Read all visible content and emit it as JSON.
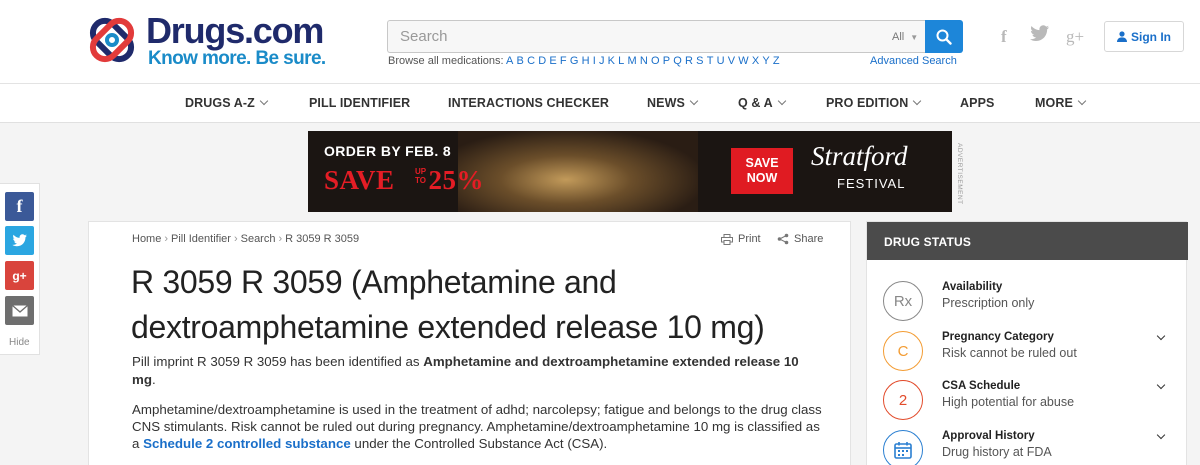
{
  "header": {
    "logo": {
      "name": "Drugs.com",
      "tagline": "Know more. Be sure."
    },
    "search": {
      "placeholder": "Search",
      "scope": "All"
    },
    "browse": {
      "label": "Browse all medications:",
      "letters": [
        "A",
        "B",
        "C",
        "D",
        "E",
        "F",
        "G",
        "H",
        "I",
        "J",
        "K",
        "L",
        "M",
        "N",
        "O",
        "P",
        "Q",
        "R",
        "S",
        "T",
        "U",
        "V",
        "W",
        "X",
        "Y",
        "Z"
      ]
    },
    "advanced_search": "Advanced Search",
    "social": {
      "facebook": "f",
      "twitter": "t",
      "googleplus": "g+"
    },
    "sign_in": "Sign In"
  },
  "nav": [
    {
      "label": "DRUGS A-Z",
      "dropdown": true
    },
    {
      "label": "PILL IDENTIFIER",
      "dropdown": false
    },
    {
      "label": "INTERACTIONS CHECKER",
      "dropdown": false
    },
    {
      "label": "NEWS",
      "dropdown": true
    },
    {
      "label": "Q & A",
      "dropdown": true
    },
    {
      "label": "PRO EDITION",
      "dropdown": true
    },
    {
      "label": "APPS",
      "dropdown": false
    },
    {
      "label": "MORE",
      "dropdown": true
    }
  ],
  "ad": {
    "order": "ORDER BY FEB. 8",
    "save": "SAVE",
    "up_to": "UP TO",
    "percent": "25%",
    "button": "SAVE NOW",
    "brand": "Stratford",
    "brand_sub": "FESTIVAL",
    "label": "ADVERTISEMENT"
  },
  "share_bar": {
    "hide": "Hide"
  },
  "breadcrumb": [
    "Home",
    "Pill Identifier",
    "Search",
    "R 3059 R 3059"
  ],
  "tools": {
    "print": "Print",
    "share": "Share"
  },
  "main": {
    "title": "R 3059 R 3059 (Amphetamine and dextroamphetamine extended release 10 mg)",
    "intro_prefix": "Pill imprint R 3059 R 3059 has been identified as ",
    "intro_bold": "Amphetamine and dextroamphetamine extended release 10 mg",
    "intro_suffix": ".",
    "desc_prefix": "Amphetamine/dextroamphetamine is used in the treatment of adhd; narcolepsy; fatigue and belongs to the drug class CNS stimulants. Risk cannot be ruled out during pregnancy. Amphetamine/dextroamphetamine 10 mg is classified as a ",
    "desc_link": "Schedule 2 controlled substance",
    "desc_suffix": " under the Controlled Substance Act (CSA)."
  },
  "drug_status": {
    "heading": "DRUG STATUS",
    "items": [
      {
        "label": "Availability",
        "value": "Prescription only",
        "badge": "Rx",
        "color": "#888888",
        "expandable": false
      },
      {
        "label": "Pregnancy Category",
        "value": "Risk cannot be ruled out",
        "badge": "C",
        "color": "#f39c33",
        "expandable": true
      },
      {
        "label": "CSA Schedule",
        "value": "High potential for abuse",
        "badge": "2",
        "color": "#e24b2b",
        "expandable": true
      },
      {
        "label": "Approval History",
        "value": "Drug history at FDA",
        "badge": "calendar-icon",
        "color": "#2a7fd1",
        "expandable": true
      }
    ]
  }
}
